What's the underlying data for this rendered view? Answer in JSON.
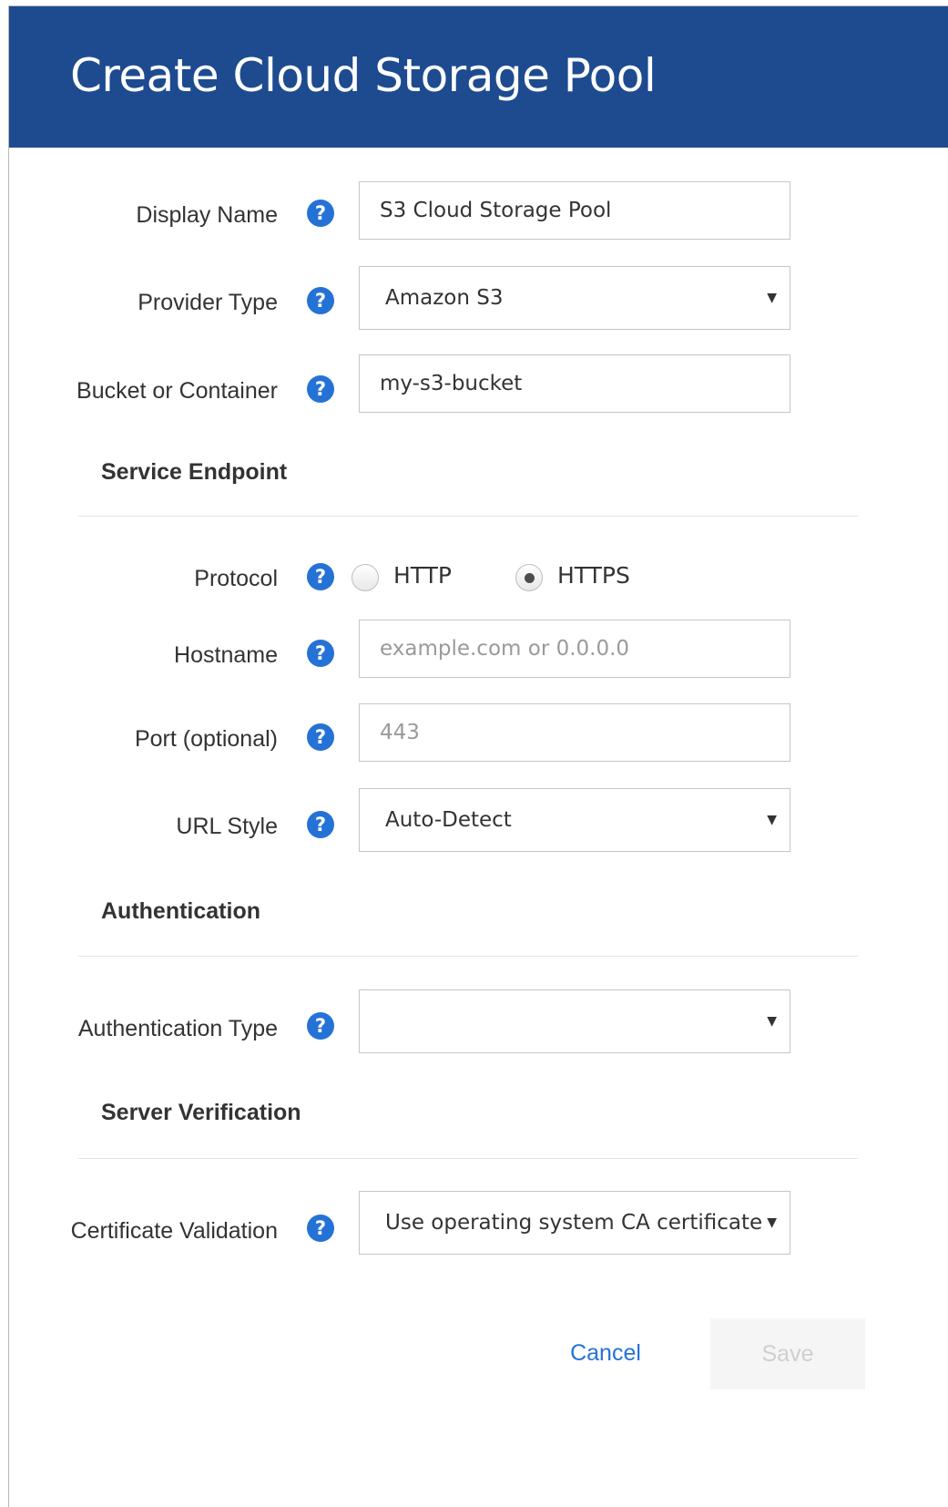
{
  "dialog": {
    "title": "Create Cloud Storage Pool",
    "help_glyph": "?"
  },
  "fields": {
    "display_name": {
      "label": "Display Name",
      "value": "S3 Cloud Storage Pool"
    },
    "provider_type": {
      "label": "Provider Type",
      "value": "Amazon S3"
    },
    "bucket": {
      "label": "Bucket or Container",
      "value": "my-s3-bucket"
    }
  },
  "service_endpoint": {
    "heading": "Service Endpoint",
    "protocol": {
      "label": "Protocol",
      "options": [
        "HTTP",
        "HTTPS"
      ],
      "selected": "HTTPS"
    },
    "hostname": {
      "label": "Hostname",
      "placeholder": "example.com or 0.0.0.0",
      "value": ""
    },
    "port": {
      "label": "Port (optional)",
      "placeholder": "443",
      "value": ""
    },
    "url_style": {
      "label": "URL Style",
      "value": "Auto-Detect"
    }
  },
  "authentication": {
    "heading": "Authentication",
    "type": {
      "label": "Authentication Type",
      "value": ""
    }
  },
  "server_verification": {
    "heading": "Server Verification",
    "certificate_validation": {
      "label": "Certificate Validation",
      "value": "Use operating system CA certificate"
    }
  },
  "actions": {
    "cancel_label": "Cancel",
    "save_label": "Save"
  },
  "icons": {
    "help": "help-icon",
    "caret": "caret-down-icon"
  },
  "colors": {
    "header": "#1e4b8f",
    "accent": "#2572d6",
    "disabled_text": "#cfcfcf"
  }
}
